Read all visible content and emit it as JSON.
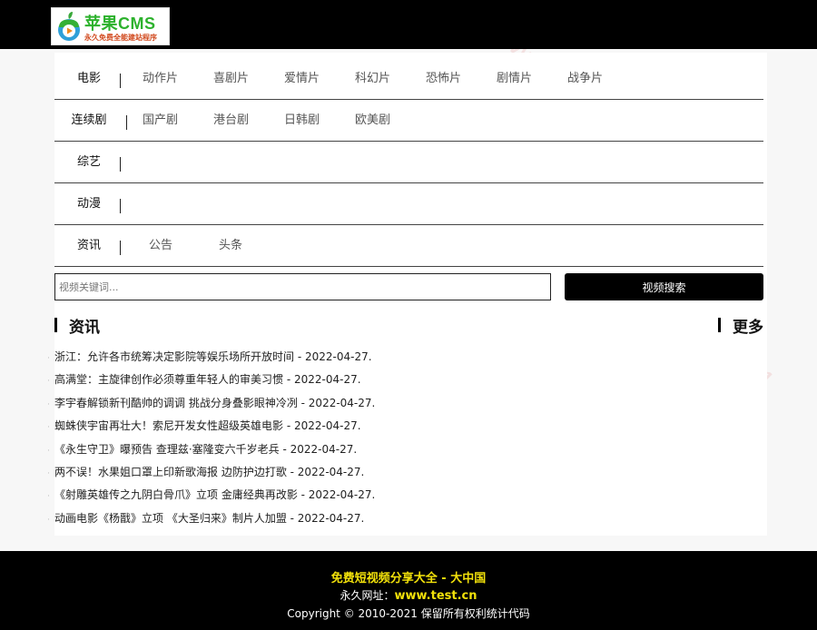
{
  "logo": {
    "title": "苹果CMS",
    "subtitle": "永久免费全能建站程序"
  },
  "nav": {
    "rows": [
      {
        "category": "电影",
        "items": [
          "动作片",
          "喜剧片",
          "爱情片",
          "科幻片",
          "恐怖片",
          "剧情片",
          "战争片"
        ]
      },
      {
        "category": "连续剧",
        "items": [
          "国产剧",
          "港台剧",
          "日韩剧",
          "欧美剧"
        ]
      },
      {
        "category": "综艺",
        "items": []
      },
      {
        "category": "动漫",
        "items": []
      },
      {
        "category": "资讯",
        "items": [
          "公告",
          "头条"
        ]
      }
    ]
  },
  "search": {
    "placeholder": "视频关键词...",
    "button_label": "视频搜索"
  },
  "news": {
    "section_title": "资讯",
    "more_label": "更多",
    "items": [
      {
        "title": "浙江：允许各市统筹决定影院等娱乐场所开放时间",
        "date": "2022-04-27."
      },
      {
        "title": "高满堂：主旋律创作必须尊重年轻人的审美习惯",
        "date": "2022-04-27."
      },
      {
        "title": "李宇春解锁新刊酷帅的调调 挑战分身叠影眼神冷冽",
        "date": "2022-04-27."
      },
      {
        "title": "蜘蛛侠宇宙再壮大！索尼开发女性超级英雄电影",
        "date": "2022-04-27."
      },
      {
        "title": "《永生守卫》曝预告 查理兹·塞隆变六千岁老兵",
        "date": "2022-04-27."
      },
      {
        "title": "两不误！水果姐口罩上印新歌海报 边防护边打歌",
        "date": "2022-04-27."
      },
      {
        "title": "《射雕英雄传之九阴白骨爪》立项 金庸经典再改影",
        "date": "2022-04-27."
      },
      {
        "title": "动画电影《杨戬》立项 《大圣归来》制片人加盟",
        "date": "2022-04-27."
      }
    ]
  },
  "footer": {
    "line1": "免费短视频分享大全 - 大中国",
    "url_label": "永久网址：",
    "url": "www.test.cn",
    "copyright": "Copyright © 2010-2021 保留所有权利统计代码"
  }
}
